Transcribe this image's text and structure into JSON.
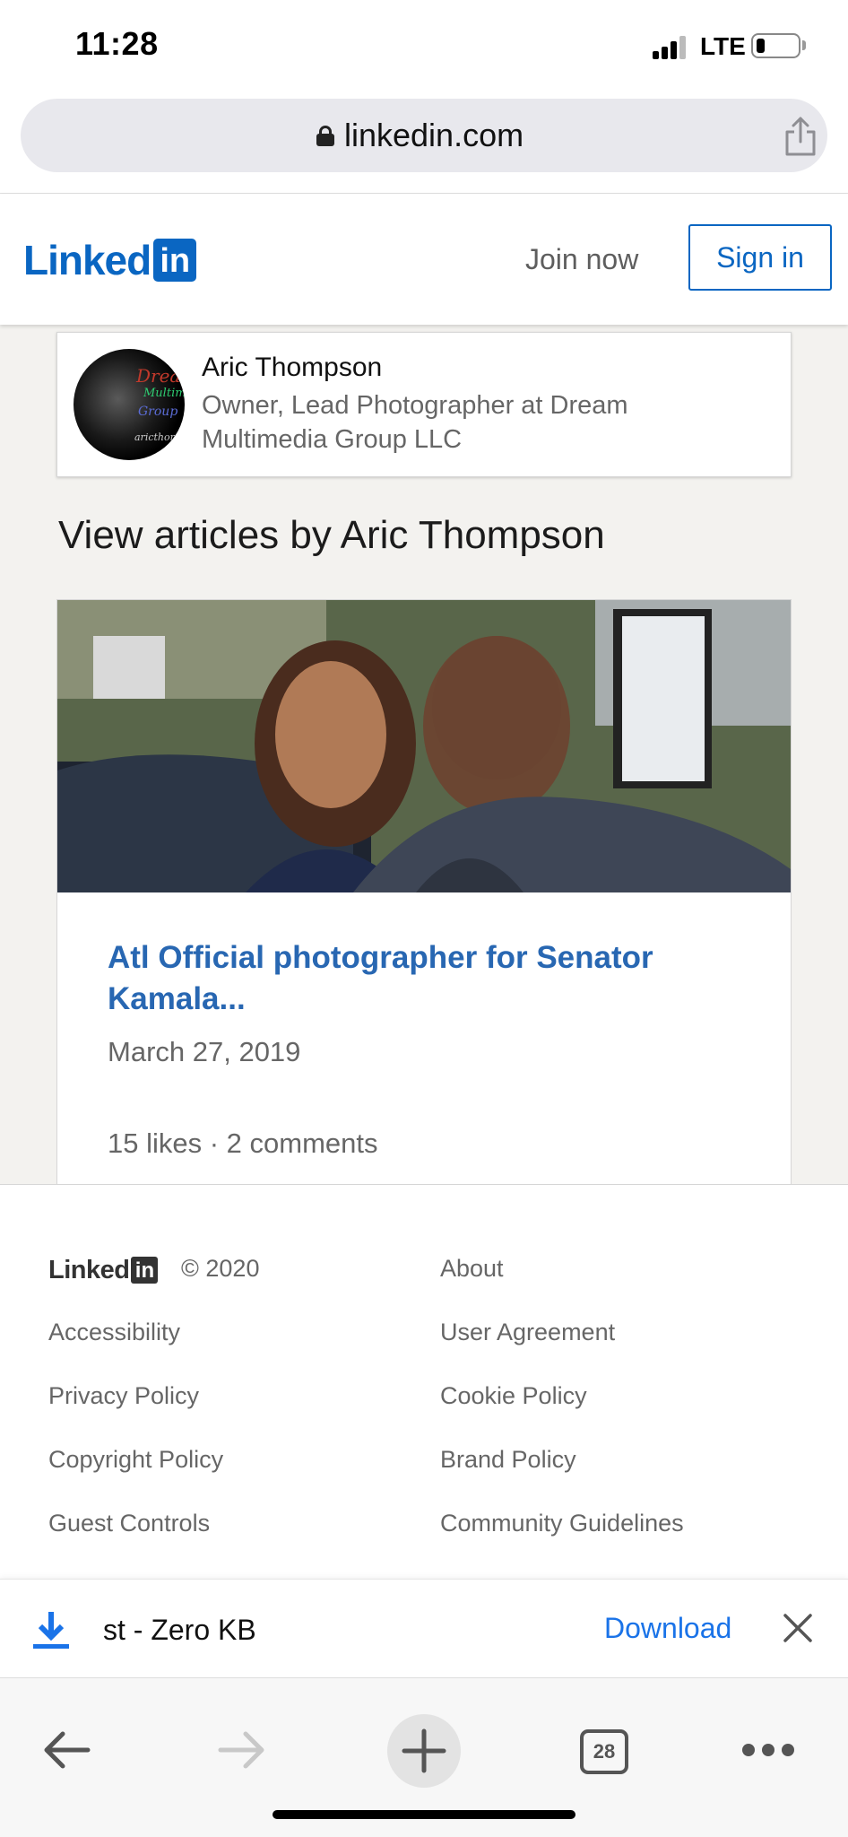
{
  "status_bar": {
    "time": "11:28",
    "network": "LTE"
  },
  "browser": {
    "url": "linkedin.com"
  },
  "header": {
    "logo_text": "Linked",
    "logo_box": "in",
    "join_now": "Join now",
    "sign_in": "Sign in"
  },
  "profile": {
    "name": "Aric Thompson",
    "headline": "Owner, Lead Photographer at Dream Multimedia Group LLC"
  },
  "articles_heading": "View articles by Aric Thompson",
  "article": {
    "title": "Atl Official photographer for Senator Kamala...",
    "date": "March 27, 2019",
    "stats": "15 likes · 2 comments"
  },
  "footer": {
    "logo_text": "Linked",
    "logo_box": "in",
    "copyright": "© 2020",
    "links_left": [
      "Accessibility",
      "Privacy Policy",
      "Copyright Policy",
      "Guest Controls"
    ],
    "links_right": [
      "About",
      "User Agreement",
      "Cookie Policy",
      "Brand Policy",
      "Community Guidelines"
    ]
  },
  "download_bar": {
    "file_name": "st - Zero KB",
    "download_label": "Download"
  },
  "toolbar": {
    "tab_count": "28"
  },
  "icons": {
    "lock": "lock-icon",
    "share": "share-icon",
    "download": "download-icon",
    "close": "close-icon",
    "back": "back-arrow-icon",
    "forward": "forward-arrow-icon",
    "new_tab": "plus-icon",
    "more": "more-dots-icon"
  },
  "colors": {
    "linkedin_blue": "#0a66c2",
    "article_link": "#2867b2",
    "download_blue": "#1a73e8"
  }
}
